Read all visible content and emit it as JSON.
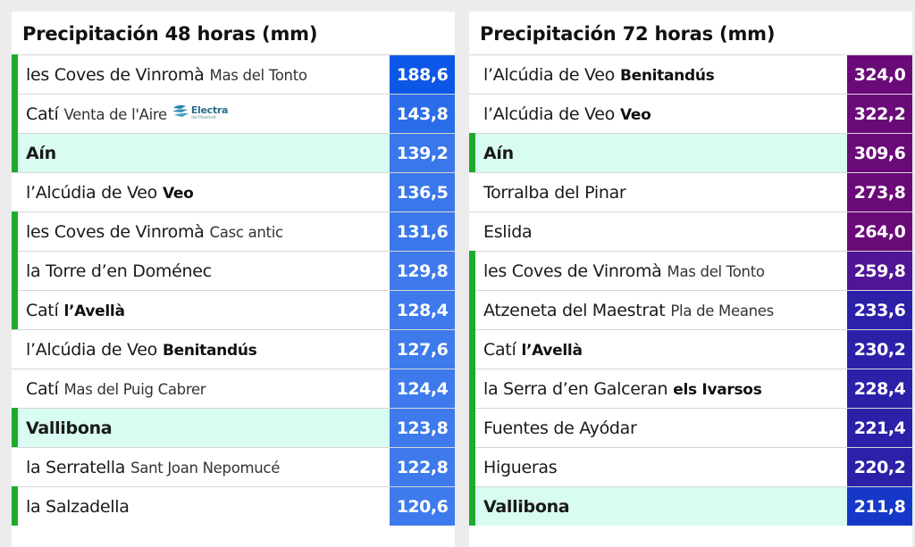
{
  "panels": [
    {
      "title": "Precipitación 48 horas (mm)",
      "rows": [
        {
          "name": "les Coves de Vinromà",
          "sub": "Mas del Tonto",
          "sub_bold": false,
          "value": "188,6",
          "color": "#0d57e6",
          "marker": true,
          "highlight": false
        },
        {
          "name": "Catí",
          "sub": "Venta de l'Aire",
          "sub_bold": false,
          "logo": "Electra",
          "value": "143,8",
          "color": "#2b6ce9",
          "marker": true,
          "highlight": false
        },
        {
          "name": "Aín",
          "sub": "",
          "sub_bold": false,
          "value": "139,2",
          "color": "#3a77ea",
          "marker": true,
          "highlight": true
        },
        {
          "name": "l’Alcúdia de Veo",
          "sub": "Veo",
          "sub_bold": true,
          "value": "136,5",
          "color": "#3a77ea",
          "marker": false,
          "highlight": false
        },
        {
          "name": "les Coves de Vinromà",
          "sub": "Casc antic",
          "sub_bold": false,
          "value": "131,6",
          "color": "#3a77ea",
          "marker": true,
          "highlight": false
        },
        {
          "name": "la Torre d’en Doménec",
          "sub": "",
          "sub_bold": false,
          "value": "129,8",
          "color": "#3e7aeb",
          "marker": true,
          "highlight": false
        },
        {
          "name": "Catí",
          "sub": "l’Avellà",
          "sub_bold": true,
          "value": "128,4",
          "color": "#3e7aeb",
          "marker": true,
          "highlight": false
        },
        {
          "name": "l’Alcúdia de Veo",
          "sub": "Benitandús",
          "sub_bold": true,
          "value": "127,6",
          "color": "#3e7aeb",
          "marker": false,
          "highlight": false
        },
        {
          "name": "Catí",
          "sub": "Mas del Puig Cabrer",
          "sub_bold": false,
          "value": "124,4",
          "color": "#3e7aeb",
          "marker": false,
          "highlight": false
        },
        {
          "name": "Vallibona",
          "sub": "",
          "sub_bold": false,
          "value": "123,8",
          "color": "#3e7aeb",
          "marker": true,
          "highlight": true
        },
        {
          "name": "la Serratella",
          "sub": "Sant Joan Nepomucé",
          "sub_bold": false,
          "value": "122,8",
          "color": "#3e7aeb",
          "marker": false,
          "highlight": false
        },
        {
          "name": "la Salzadella",
          "sub": "",
          "sub_bold": false,
          "value": "120,6",
          "color": "#3e7aeb",
          "marker": true,
          "highlight": false
        }
      ]
    },
    {
      "title": "Precipitación 72 horas (mm)",
      "rows": [
        {
          "name": "l’Alcúdia de Veo",
          "sub": "Benitandús",
          "sub_bold": true,
          "value": "324,0",
          "color": "#6a0a78",
          "marker": false,
          "highlight": false
        },
        {
          "name": "l’Alcúdia de Veo",
          "sub": "Veo",
          "sub_bold": true,
          "value": "322,2",
          "color": "#6a0a78",
          "marker": false,
          "highlight": false
        },
        {
          "name": "Aín",
          "sub": "",
          "sub_bold": false,
          "value": "309,6",
          "color": "#6a0a78",
          "marker": true,
          "highlight": true
        },
        {
          "name": "Torralba del Pinar",
          "sub": "",
          "sub_bold": false,
          "value": "273,8",
          "color": "#6a0a78",
          "marker": false,
          "highlight": false
        },
        {
          "name": "Eslida",
          "sub": "",
          "sub_bold": false,
          "value": "264,0",
          "color": "#6a0a78",
          "marker": false,
          "highlight": false
        },
        {
          "name": "les Coves de Vinromà",
          "sub": "Mas del Tonto",
          "sub_bold": false,
          "value": "259,8",
          "color": "#4f1596",
          "marker": true,
          "highlight": false
        },
        {
          "name": "Atzeneta del Maestrat",
          "sub": "Pla de Meanes",
          "sub_bold": false,
          "value": "233,6",
          "color": "#2d20a8",
          "marker": true,
          "highlight": false
        },
        {
          "name": "Catí",
          "sub": "l’Avellà",
          "sub_bold": true,
          "value": "230,2",
          "color": "#2d20a8",
          "marker": true,
          "highlight": false
        },
        {
          "name": "la Serra d’en Galceran",
          "sub": "els Ivarsos",
          "sub_bold": true,
          "value": "228,4",
          "color": "#2d20a8",
          "marker": true,
          "highlight": false
        },
        {
          "name": "Fuentes de Ayódar",
          "sub": "",
          "sub_bold": false,
          "value": "221,4",
          "color": "#2d20a8",
          "marker": true,
          "highlight": false
        },
        {
          "name": "Higueras",
          "sub": "",
          "sub_bold": false,
          "value": "220,2",
          "color": "#2d20a8",
          "marker": true,
          "highlight": false
        },
        {
          "name": "Vallibona",
          "sub": "",
          "sub_bold": false,
          "value": "211,8",
          "color": "#1638c8",
          "marker": true,
          "highlight": true
        }
      ]
    }
  ],
  "logo": {
    "name": "Electra",
    "tagline": "del Maestrat"
  }
}
